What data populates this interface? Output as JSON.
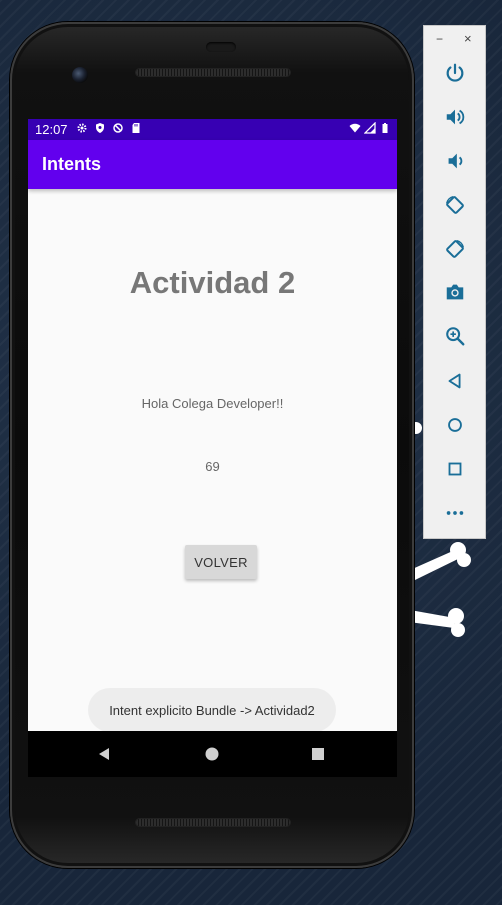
{
  "status_bar": {
    "time": "12:07"
  },
  "app_bar": {
    "title": "Intents"
  },
  "content": {
    "heading": "Actividad 2",
    "greeting": "Hola Colega Developer!!",
    "number": "69",
    "button_label": "VOLVER"
  },
  "toast": {
    "message": "Intent explicito Bundle -> Actividad2"
  },
  "toolbar": {
    "minimize_label": "−",
    "close_label": "×",
    "buttons": [
      "power-icon",
      "volume-up-icon",
      "volume-down-icon",
      "rotate-left-icon",
      "rotate-right-icon",
      "camera-icon",
      "zoom-icon",
      "back-icon",
      "home-icon",
      "overview-icon",
      "more-icon"
    ]
  },
  "colors": {
    "status_bar": "#3700b3",
    "app_bar": "#6200ee",
    "screen_bg": "#fafafa",
    "button_bg": "#d8d8d8",
    "toast_bg": "#ededed",
    "toolbar_icon": "#1a6e98"
  }
}
